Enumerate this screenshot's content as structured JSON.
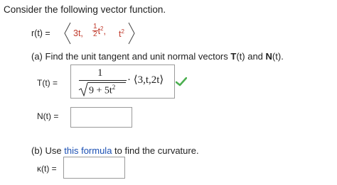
{
  "intro": "Consider the following vector function.",
  "r_def": {
    "label": "r(t) =",
    "comp1": "3t,",
    "comp2_num": "1",
    "comp2_den": "2",
    "comp2_var": "t",
    "comp2_exp": "2",
    "comp3_var": "t",
    "comp3_exp": "2"
  },
  "part_a": {
    "prefix": "(a) Find the unit tangent and unit normal vectors ",
    "bold1": "T",
    "mid1": "(t) and ",
    "bold2": "N",
    "mid2": "(t).",
    "T_label": "T(t) =",
    "T_num": "1",
    "T_den": "9 + 5t",
    "T_den_exp": "2",
    "T_vec": "· ⟨3,t,2t⟩",
    "T_status": "correct",
    "N_label": "N(t) =",
    "N_value": ""
  },
  "part_b": {
    "prefix": "(b) Use ",
    "link": "this formula",
    "suffix": " to find the curvature.",
    "kappa_label": "κ(t) =",
    "kappa_value": ""
  },
  "colors": {
    "correct": "#4caf50",
    "link": "#1a4fb3",
    "input_red": "#c0392b"
  }
}
